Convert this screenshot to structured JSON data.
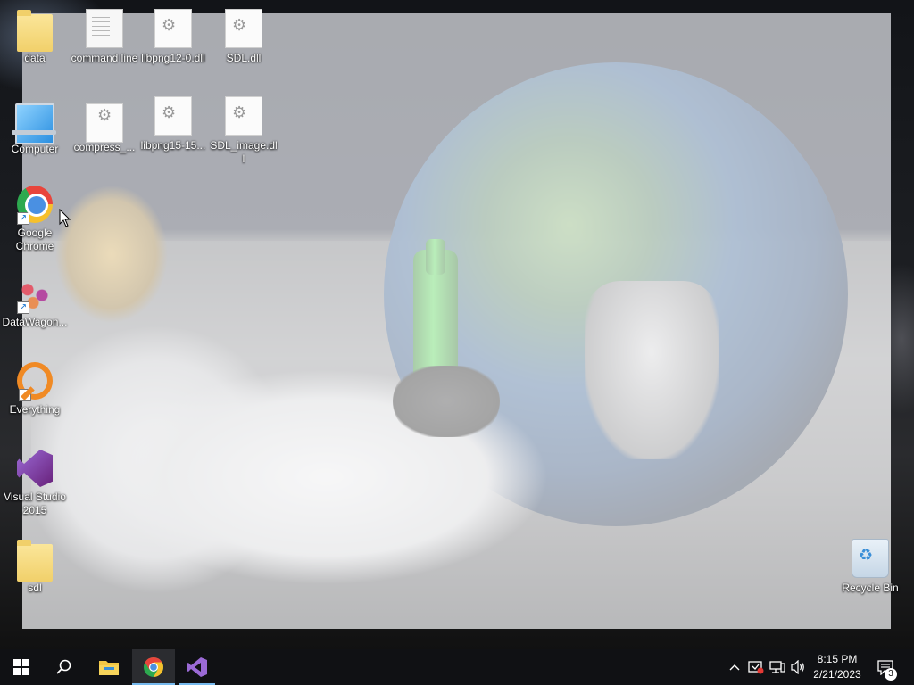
{
  "desktop": {
    "icons": [
      {
        "label": "data"
      },
      {
        "label": "command line"
      },
      {
        "label": "libpng12-0.dll"
      },
      {
        "label": "SDL.dll"
      },
      {
        "label": "Computer"
      },
      {
        "label": "compress_..."
      },
      {
        "label": "libpng15-15..."
      },
      {
        "label": "SDL_image.dll"
      },
      {
        "label": "Google Chrome"
      },
      {
        "label": "DataWagon..."
      },
      {
        "label": "Everything"
      },
      {
        "label": "Visual Studio 2015"
      },
      {
        "label": "sdl"
      },
      {
        "label": "Recycle Bin"
      }
    ]
  },
  "taskbar": {
    "start_icon": "windows-logo-icon",
    "search_icon": "search-icon",
    "pinned": [
      {
        "name": "file-explorer-icon",
        "color": "#f2c744"
      },
      {
        "name": "chrome-icon",
        "color": "#4a90e2"
      },
      {
        "name": "visual-studio-icon",
        "color": "#9b6ad6"
      }
    ],
    "tray": {
      "time": "8:15 PM",
      "date": "2/21/2023",
      "notification_count": "3"
    }
  },
  "colors": {
    "taskbar_bg": "#101114",
    "accent": "#76b9ed",
    "overlay": "rgba(255,255,255,0.62)"
  }
}
